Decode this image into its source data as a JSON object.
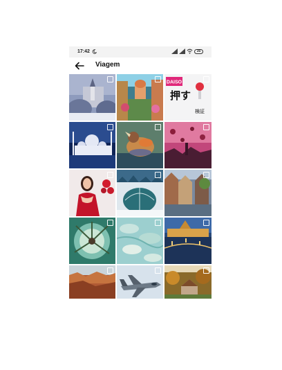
{
  "status_bar": {
    "time": "17:42",
    "battery": "35"
  },
  "header": {
    "title": "Viagem"
  },
  "tile3": {
    "brand": "DAISO",
    "text_big": "押す",
    "text_small": "検証"
  },
  "grid": [
    {
      "name": "snowy-castle"
    },
    {
      "name": "colorful-village-street"
    },
    {
      "name": "daiso-ad"
    },
    {
      "name": "white-mosque-night"
    },
    {
      "name": "mandarin-duck"
    },
    {
      "name": "balloons-pink-sky"
    },
    {
      "name": "woman-red-dress"
    },
    {
      "name": "glass-igloo-snow"
    },
    {
      "name": "old-houses-river"
    },
    {
      "name": "tree-underwater-view"
    },
    {
      "name": "turquoise-water-rocks"
    },
    {
      "name": "parliament-night-city"
    },
    {
      "name": "canyon-landscape"
    },
    {
      "name": "fighter-jet"
    },
    {
      "name": "autumn-village"
    }
  ]
}
